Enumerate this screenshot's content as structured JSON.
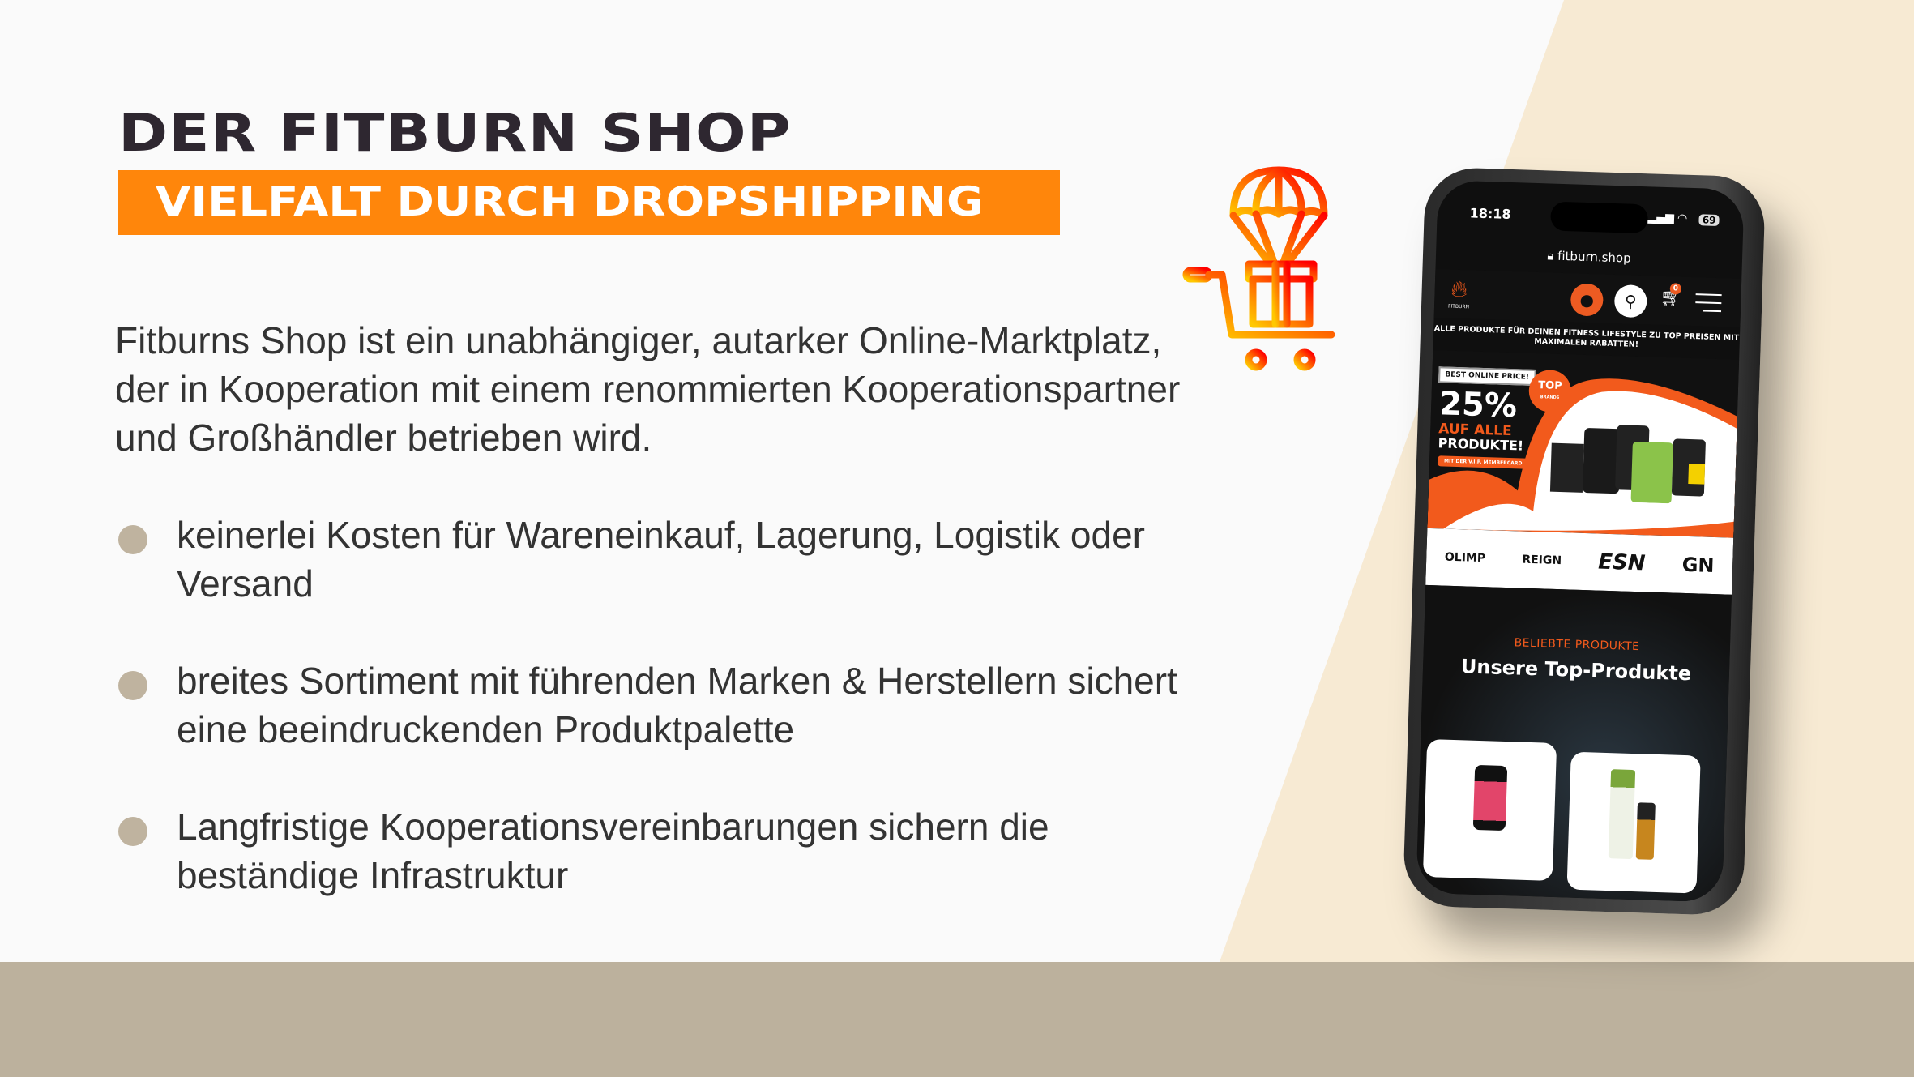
{
  "heading": {
    "title": "DER FITBURN SHOP",
    "subtitle": "VIELFALT DURCH DROPSHIPPING"
  },
  "intro": "Fitburns Shop ist ein unabhängiger, autarker Online-Marktplatz, der in Kooperation mit einem renommierten Kooperationspartner und Großhändler betrieben wird.",
  "bullets": [
    "keinerlei Kosten für Wareneinkauf, Lagerung, Logistik oder Versand",
    "breites Sortiment mit führenden Marken & Herstellern sichert eine beeindruckenden Produktpalette",
    "Langfristige Kooperationsvereinbarungen sichern die beständige Infrastruktur"
  ],
  "colors": {
    "accent": "#ff860b",
    "title": "#2e2730",
    "beige": "#f7ead3",
    "band": "#bcb19d",
    "shop_orange": "#f25a1c"
  },
  "phone": {
    "time": "18:18",
    "battery": "69",
    "url": "fitburn.shop",
    "logo_text": "FITBURN",
    "cart_count": "0",
    "tagline": "ALLE PRODUKTE FÜR DEINEN FITNESS LIFESTYLE ZU TOP PREISEN MIT MAXIMALEN RABATTEN!",
    "banner": {
      "badge": "BEST ONLINE PRICE!",
      "percent": "25%",
      "line1": "AUF ALLE",
      "line2": "PRODUKTE!",
      "cta": "MIT DER V.I.P. MEMBERCARD",
      "top": "TOP",
      "top_sub": "BRANDS"
    },
    "brands": [
      "OLIMP",
      "REIGN",
      "ESN",
      "GN"
    ],
    "section_label": "BELIEBTE PRODUKTE",
    "section_title": "Unsere Top-Produkte"
  }
}
